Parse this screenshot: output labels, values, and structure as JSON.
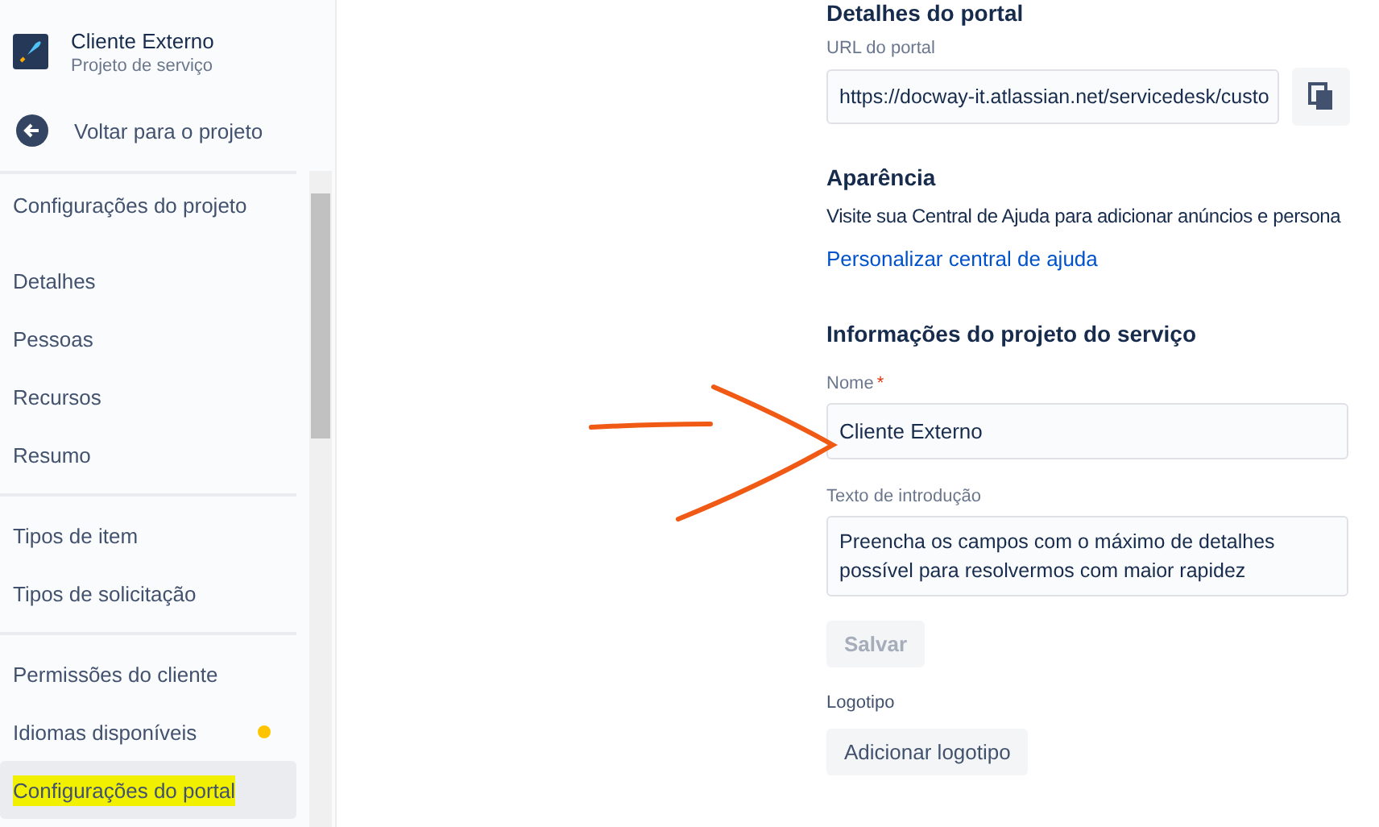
{
  "project": {
    "name": "Cliente Externo",
    "type": "Projeto de serviço"
  },
  "back_link": "Voltar para o projeto",
  "sidebar": {
    "heading": "Configurações do projeto",
    "groups": [
      [
        {
          "label": "Detalhes",
          "selected": false,
          "dot": false
        },
        {
          "label": "Pessoas",
          "selected": false,
          "dot": false
        },
        {
          "label": "Recursos",
          "selected": false,
          "dot": false
        },
        {
          "label": "Resumo",
          "selected": false,
          "dot": false
        }
      ],
      [
        {
          "label": "Tipos de item",
          "selected": false,
          "dot": false
        },
        {
          "label": "Tipos de solicitação",
          "selected": false,
          "dot": false
        }
      ],
      [
        {
          "label": "Permissões do cliente",
          "selected": false,
          "dot": false
        },
        {
          "label": "Idiomas disponíveis",
          "selected": false,
          "dot": true
        },
        {
          "label": "Configurações do portal",
          "selected": true,
          "dot": false,
          "highlighted": true
        }
      ]
    ]
  },
  "portal_details": {
    "heading": "Detalhes do portal",
    "url_label": "URL do portal",
    "url_value": "https://docway-it.atlassian.net/servicedesk/custo"
  },
  "appearance": {
    "heading": "Aparência",
    "text": "Visite sua Central de Ajuda para adicionar anúncios e persona",
    "link": "Personalizar central de ajuda"
  },
  "service_info": {
    "heading": "Informações do projeto do serviço",
    "name_label": "Nome",
    "required_mark": "*",
    "name_value": "Cliente Externo",
    "intro_label": "Texto de introdução",
    "intro_value": "Preencha os campos com o máximo de detalhes possível para resolvermos com maior rapidez",
    "save_button": {
      "label": "Salvar",
      "disabled": true
    },
    "logo_label": "Logotipo",
    "logo_button": "Adicionar logotipo"
  }
}
